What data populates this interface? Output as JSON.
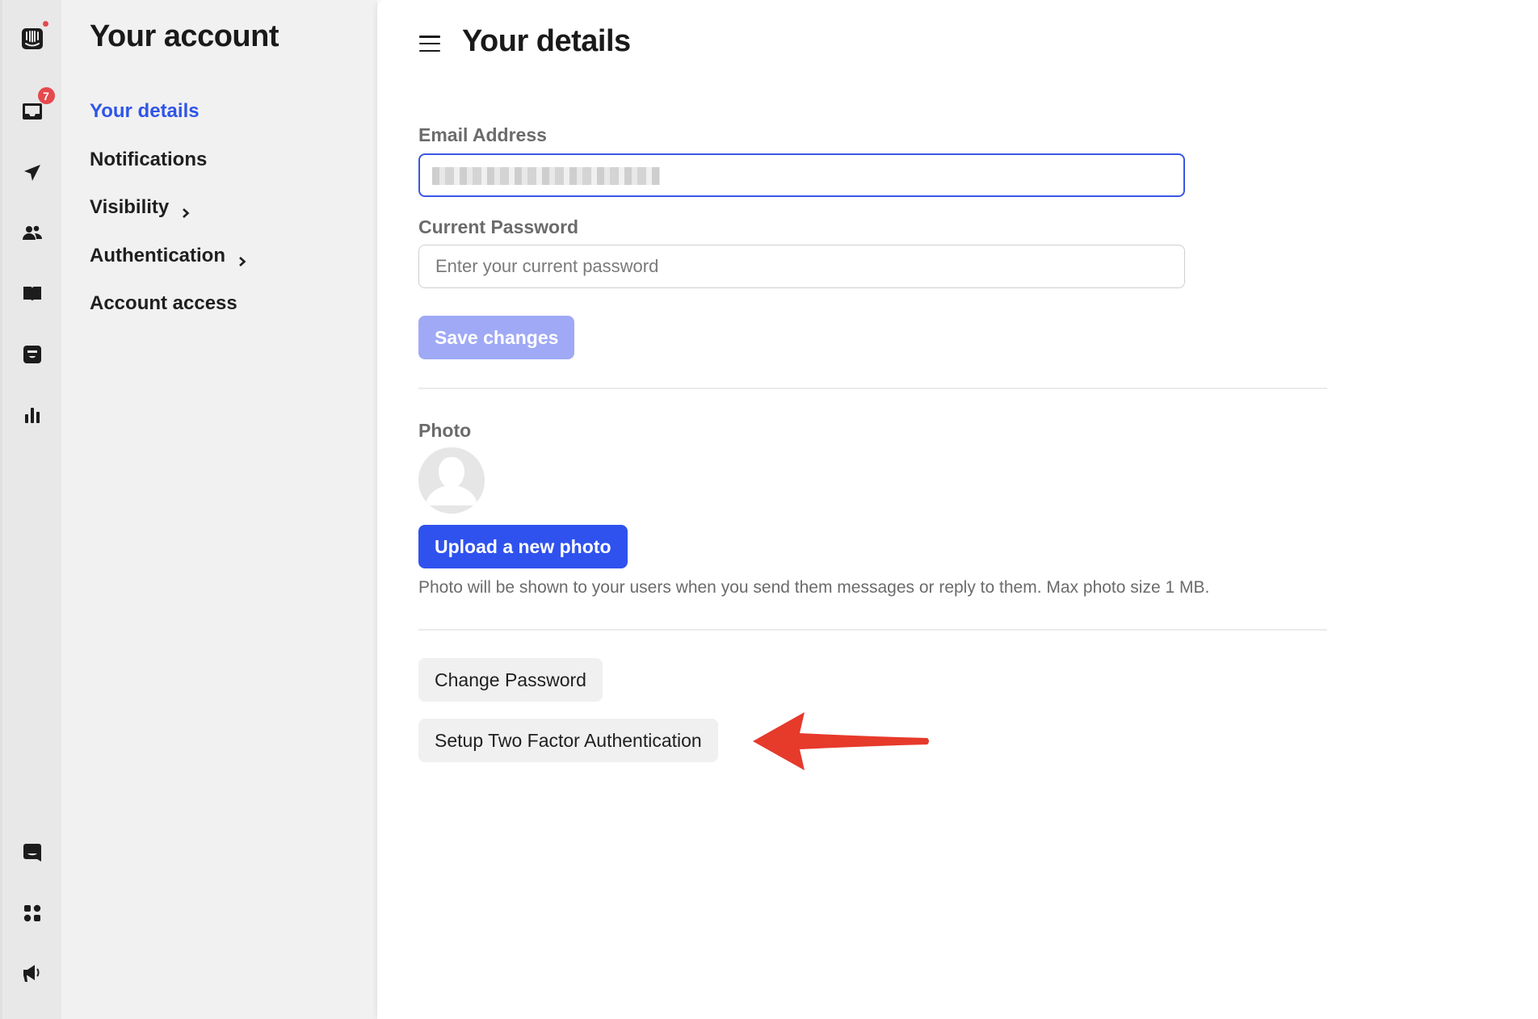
{
  "rail": {
    "top_icons": [
      {
        "name": "app-logo-icon",
        "badge": "dot"
      },
      {
        "name": "inbox-icon",
        "badge": "7"
      },
      {
        "name": "outbound-send-icon"
      },
      {
        "name": "contacts-icon"
      },
      {
        "name": "knowledge-book-icon"
      },
      {
        "name": "database-icon"
      },
      {
        "name": "reports-chart-icon"
      }
    ],
    "bottom_icons": [
      {
        "name": "messenger-chat-icon"
      },
      {
        "name": "apps-grid-icon"
      },
      {
        "name": "announcements-megaphone-icon"
      }
    ],
    "inbox_badge": "7"
  },
  "sidebar": {
    "title": "Your account",
    "items": [
      {
        "label": "Your details",
        "active": true,
        "has_chevron": false
      },
      {
        "label": "Notifications",
        "active": false,
        "has_chevron": false
      },
      {
        "label": "Visibility",
        "active": false,
        "has_chevron": true
      },
      {
        "label": "Authentication",
        "active": false,
        "has_chevron": true
      },
      {
        "label": "Account access",
        "active": false,
        "has_chevron": false
      }
    ]
  },
  "main": {
    "title": "Your details",
    "email": {
      "label": "Email Address",
      "value": "",
      "value_redacted": true
    },
    "password": {
      "label": "Current Password",
      "placeholder": "Enter your current password",
      "value": ""
    },
    "save_button": "Save changes",
    "photo": {
      "label": "Photo",
      "upload_button": "Upload a new photo",
      "help_text": "Photo will be shown to your users when you send them messages or reply to them. Max photo size 1 MB."
    },
    "change_password_button": "Change Password",
    "two_factor_button": "Setup Two Factor Authentication"
  },
  "colors": {
    "accent": "#2f52ee",
    "accent_disabled": "#a0a9f5",
    "active_nav": "#2f55e8",
    "badge": "#e5484d",
    "annotation_arrow": "#e63a2b"
  }
}
